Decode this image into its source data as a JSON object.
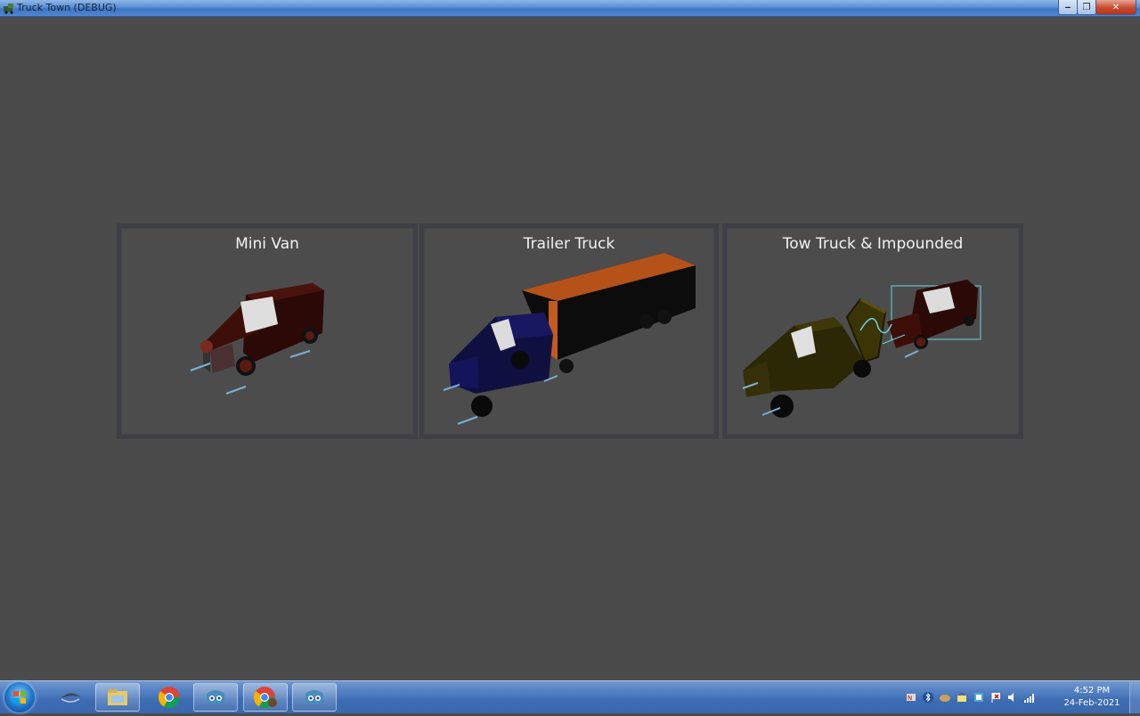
{
  "window": {
    "title": "Truck Town (DEBUG)",
    "controls": {
      "minimize": "‒",
      "maximize": "❐",
      "close": "✕"
    }
  },
  "vehicles": [
    {
      "title": "Mini Van",
      "body_color": "#3a0d08",
      "accent": "#6a1a10"
    },
    {
      "title": "Trailer Truck",
      "body_color": "#0e0f4f",
      "trailer_color": "#b5521a"
    },
    {
      "title": "Tow Truck & Impounded",
      "body_color": "#3b3405",
      "impound_color": "#3a0d08",
      "debug_color": "#6fd3e0"
    }
  ],
  "taskbar": {
    "items": [
      "windows-start-icon",
      "steam-icon",
      "file-explorer-icon",
      "chrome-icon",
      "godot-icon",
      "chrome-profile-icon",
      "godot-icon"
    ],
    "clock": {
      "time": "4:52 PM",
      "date": "24-Feb-2021"
    },
    "tray_icons": [
      "network-icon",
      "bluetooth-icon",
      "cloud-icon",
      "security-icon",
      "update-icon",
      "flag-icon",
      "volume-icon",
      "signal-icon"
    ]
  },
  "colors": {
    "background": "#4b4b4b",
    "card_border": "#3f3f46",
    "title_text": "#f2f2f2"
  }
}
